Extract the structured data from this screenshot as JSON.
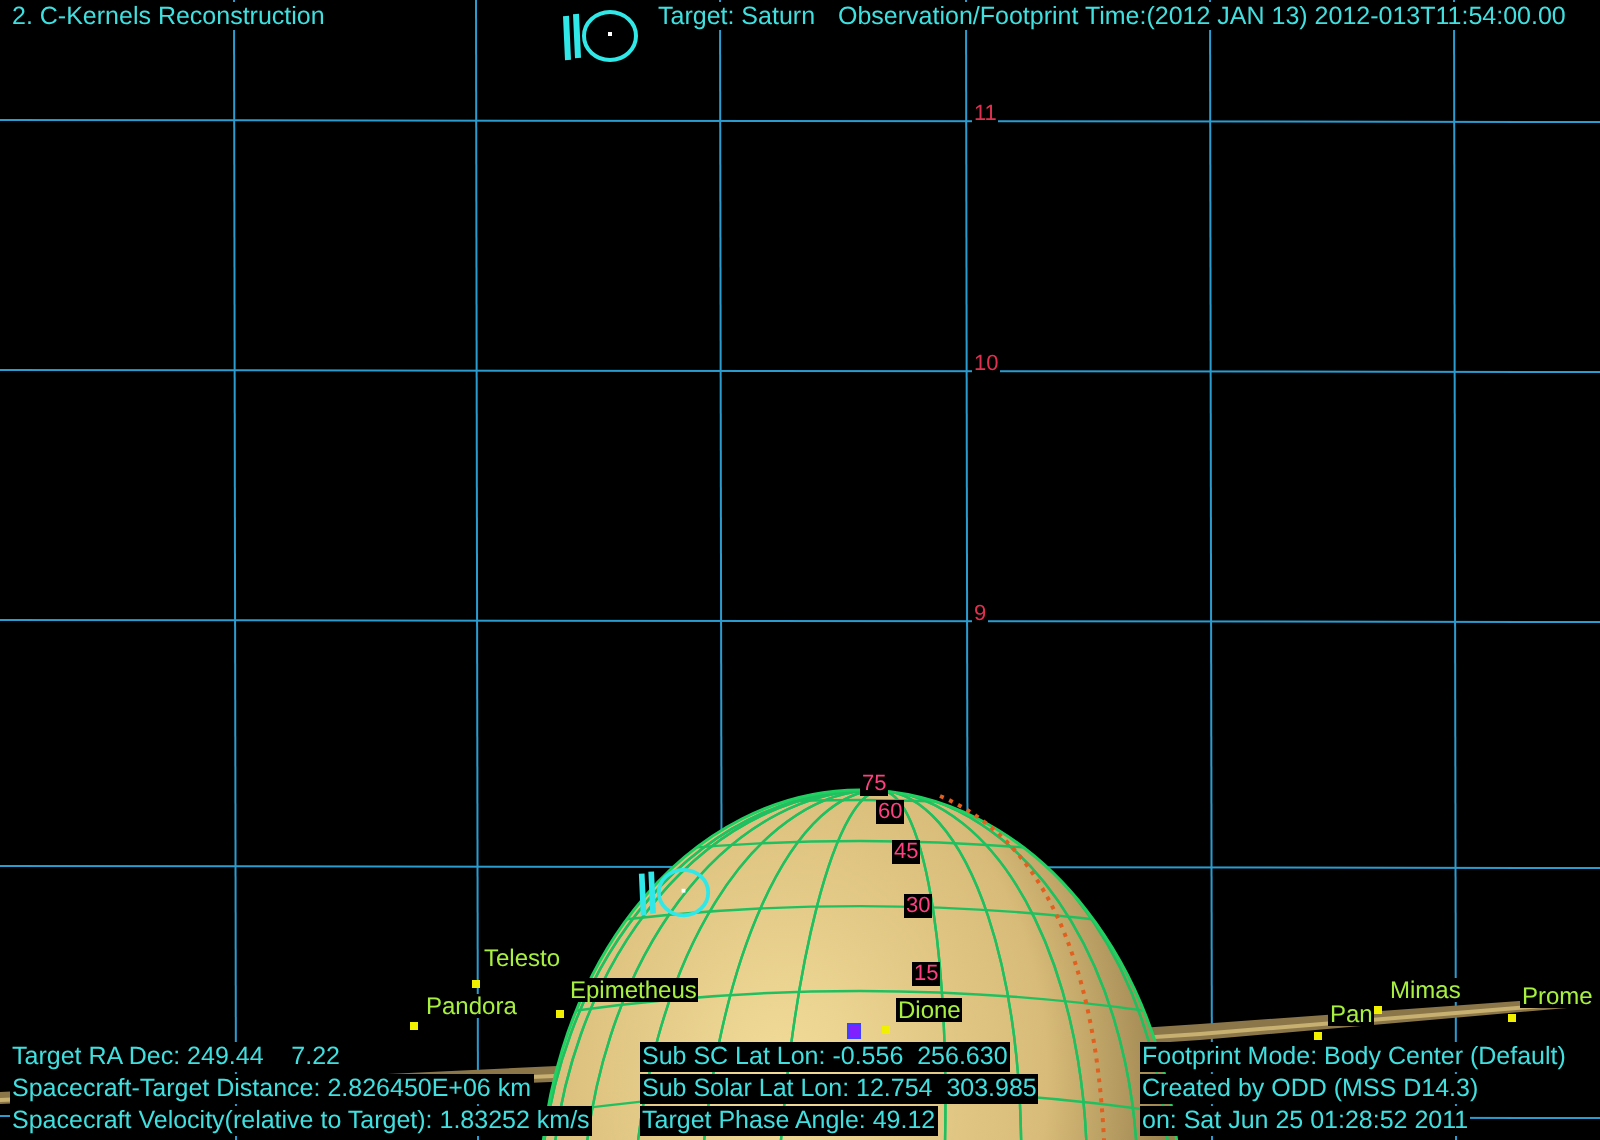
{
  "header": {
    "title": "2. C-Kernels Reconstruction",
    "target": "Target: Saturn",
    "time": "Observation/Footprint Time:(2012 JAN 13) 2012-013T11:54:00.00"
  },
  "grid_labels": [
    "11",
    "10",
    "9"
  ],
  "latitude_labels": [
    "75",
    "60",
    "45",
    "30",
    "15"
  ],
  "moons": [
    {
      "name": "Telesto"
    },
    {
      "name": "Pandora"
    },
    {
      "name": "Epimetheus"
    },
    {
      "name": "Dione"
    },
    {
      "name": "Pan"
    },
    {
      "name": "Mimas"
    },
    {
      "name": "Prome"
    }
  ],
  "info_left": [
    "Target RA Dec: 249.44    7.22",
    "Spacecraft-Target Distance: 2.826450E+06 km",
    "Spacecraft Velocity(relative to Target): 1.83252 km/s"
  ],
  "info_middle": [
    "Sub SC Lat Lon: -0.556  256.630",
    "Sub Solar Lat Lon: 12.754  303.985",
    "Target Phase Angle: 49.12"
  ],
  "info_right": [
    "Footprint Mode: Body Center (Default)",
    "Created by ODD (MSS D14.3)",
    "on: Sat Jun 25 01:28:52 2011"
  ]
}
